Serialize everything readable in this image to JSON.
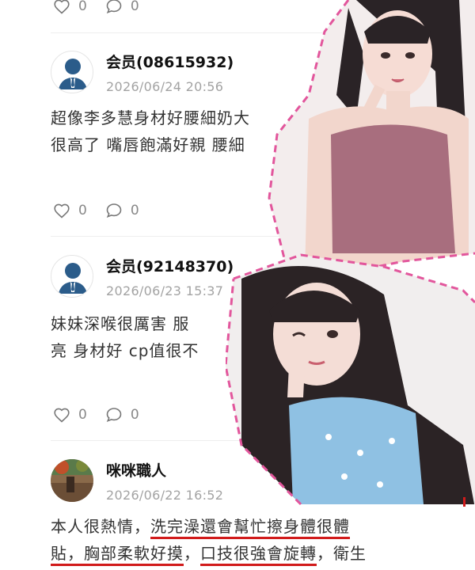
{
  "colors": {
    "accent_underline": "#d11b1b",
    "dash_border": "#e2569c",
    "avatar_blue": "#2b5c8a"
  },
  "actions": [
    {
      "likes": "0",
      "comments": "0"
    },
    {
      "likes": "0",
      "comments": "0"
    },
    {
      "likes": "0",
      "comments": "0"
    }
  ],
  "comments": [
    {
      "username": "会员(08615932)",
      "date": "2026/06/24 20:56",
      "lines": [
        "超像李多慧身材好腰細奶大",
        "很高了 嘴唇飽滿好親 腰細"
      ],
      "avatar_icon": "default-user-icon"
    },
    {
      "username": "会员(92148370)",
      "date": "2026/06/23 15:37",
      "lines": [
        "妹妹深喉很厲害 服",
        "亮 身材好 cp值很不"
      ],
      "avatar_icon": "default-user-icon"
    },
    {
      "username": "咪咪職人",
      "date": "2026/06/22 16:52",
      "line1_pre": "本人很熱情，",
      "line1_ul": "洗完澡還會幫忙擦身體很體",
      "line2_ul1": "貼，胸部柔軟好摸",
      "line2_mid": "，",
      "line2_ul2": "口技很強會旋轉",
      "line2_post": "，衛生",
      "avatar_icon": "photo-avatar"
    }
  ]
}
